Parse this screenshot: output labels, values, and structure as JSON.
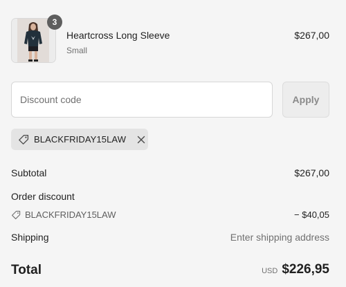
{
  "product": {
    "quantity": "3",
    "name": "Heartcross Long Sleeve",
    "variant": "Small",
    "price": "$267,00",
    "image_icon": "product-photo"
  },
  "discount": {
    "placeholder": "Discount code",
    "value": "",
    "apply_label": "Apply",
    "applied_code": "BLACKFRIDAY15LAW",
    "tag_icon": "tag-icon",
    "remove_icon": "close-icon"
  },
  "summary": {
    "subtotal_label": "Subtotal",
    "subtotal_value": "$267,00",
    "order_discount_label": "Order discount",
    "discount_code": "BLACKFRIDAY15LAW",
    "discount_value": "− $40,05",
    "shipping_label": "Shipping",
    "shipping_value": "Enter shipping address",
    "total_label": "Total",
    "total_currency": "USD",
    "total_value": "$226,95"
  },
  "colors": {
    "background": "#f5f5f5",
    "text": "#1f1f1f",
    "muted": "#707070",
    "badge": "#5e5e5e",
    "tag_bg": "#e4e4e4"
  }
}
